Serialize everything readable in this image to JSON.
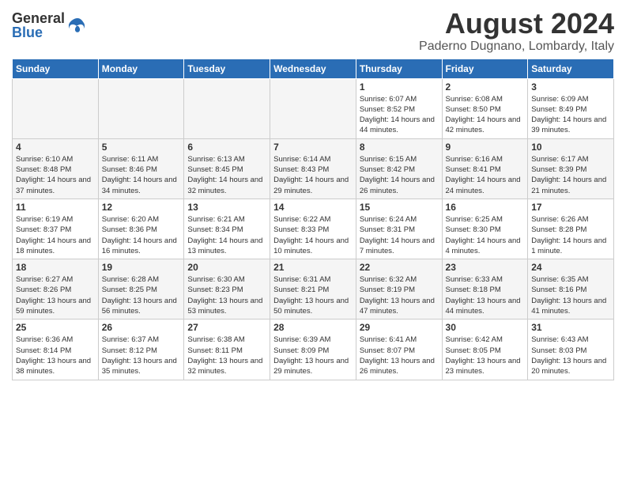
{
  "logo": {
    "general": "General",
    "blue": "Blue"
  },
  "title": {
    "month": "August 2024",
    "location": "Paderno Dugnano, Lombardy, Italy"
  },
  "headers": [
    "Sunday",
    "Monday",
    "Tuesday",
    "Wednesday",
    "Thursday",
    "Friday",
    "Saturday"
  ],
  "weeks": [
    [
      {
        "day": "",
        "info": ""
      },
      {
        "day": "",
        "info": ""
      },
      {
        "day": "",
        "info": ""
      },
      {
        "day": "",
        "info": ""
      },
      {
        "day": "1",
        "info": "Sunrise: 6:07 AM\nSunset: 8:52 PM\nDaylight: 14 hours and 44 minutes."
      },
      {
        "day": "2",
        "info": "Sunrise: 6:08 AM\nSunset: 8:50 PM\nDaylight: 14 hours and 42 minutes."
      },
      {
        "day": "3",
        "info": "Sunrise: 6:09 AM\nSunset: 8:49 PM\nDaylight: 14 hours and 39 minutes."
      }
    ],
    [
      {
        "day": "4",
        "info": "Sunrise: 6:10 AM\nSunset: 8:48 PM\nDaylight: 14 hours and 37 minutes."
      },
      {
        "day": "5",
        "info": "Sunrise: 6:11 AM\nSunset: 8:46 PM\nDaylight: 14 hours and 34 minutes."
      },
      {
        "day": "6",
        "info": "Sunrise: 6:13 AM\nSunset: 8:45 PM\nDaylight: 14 hours and 32 minutes."
      },
      {
        "day": "7",
        "info": "Sunrise: 6:14 AM\nSunset: 8:43 PM\nDaylight: 14 hours and 29 minutes."
      },
      {
        "day": "8",
        "info": "Sunrise: 6:15 AM\nSunset: 8:42 PM\nDaylight: 14 hours and 26 minutes."
      },
      {
        "day": "9",
        "info": "Sunrise: 6:16 AM\nSunset: 8:41 PM\nDaylight: 14 hours and 24 minutes."
      },
      {
        "day": "10",
        "info": "Sunrise: 6:17 AM\nSunset: 8:39 PM\nDaylight: 14 hours and 21 minutes."
      }
    ],
    [
      {
        "day": "11",
        "info": "Sunrise: 6:19 AM\nSunset: 8:37 PM\nDaylight: 14 hours and 18 minutes."
      },
      {
        "day": "12",
        "info": "Sunrise: 6:20 AM\nSunset: 8:36 PM\nDaylight: 14 hours and 16 minutes."
      },
      {
        "day": "13",
        "info": "Sunrise: 6:21 AM\nSunset: 8:34 PM\nDaylight: 14 hours and 13 minutes."
      },
      {
        "day": "14",
        "info": "Sunrise: 6:22 AM\nSunset: 8:33 PM\nDaylight: 14 hours and 10 minutes."
      },
      {
        "day": "15",
        "info": "Sunrise: 6:24 AM\nSunset: 8:31 PM\nDaylight: 14 hours and 7 minutes."
      },
      {
        "day": "16",
        "info": "Sunrise: 6:25 AM\nSunset: 8:30 PM\nDaylight: 14 hours and 4 minutes."
      },
      {
        "day": "17",
        "info": "Sunrise: 6:26 AM\nSunset: 8:28 PM\nDaylight: 14 hours and 1 minute."
      }
    ],
    [
      {
        "day": "18",
        "info": "Sunrise: 6:27 AM\nSunset: 8:26 PM\nDaylight: 13 hours and 59 minutes."
      },
      {
        "day": "19",
        "info": "Sunrise: 6:28 AM\nSunset: 8:25 PM\nDaylight: 13 hours and 56 minutes."
      },
      {
        "day": "20",
        "info": "Sunrise: 6:30 AM\nSunset: 8:23 PM\nDaylight: 13 hours and 53 minutes."
      },
      {
        "day": "21",
        "info": "Sunrise: 6:31 AM\nSunset: 8:21 PM\nDaylight: 13 hours and 50 minutes."
      },
      {
        "day": "22",
        "info": "Sunrise: 6:32 AM\nSunset: 8:19 PM\nDaylight: 13 hours and 47 minutes."
      },
      {
        "day": "23",
        "info": "Sunrise: 6:33 AM\nSunset: 8:18 PM\nDaylight: 13 hours and 44 minutes."
      },
      {
        "day": "24",
        "info": "Sunrise: 6:35 AM\nSunset: 8:16 PM\nDaylight: 13 hours and 41 minutes."
      }
    ],
    [
      {
        "day": "25",
        "info": "Sunrise: 6:36 AM\nSunset: 8:14 PM\nDaylight: 13 hours and 38 minutes."
      },
      {
        "day": "26",
        "info": "Sunrise: 6:37 AM\nSunset: 8:12 PM\nDaylight: 13 hours and 35 minutes."
      },
      {
        "day": "27",
        "info": "Sunrise: 6:38 AM\nSunset: 8:11 PM\nDaylight: 13 hours and 32 minutes."
      },
      {
        "day": "28",
        "info": "Sunrise: 6:39 AM\nSunset: 8:09 PM\nDaylight: 13 hours and 29 minutes."
      },
      {
        "day": "29",
        "info": "Sunrise: 6:41 AM\nSunset: 8:07 PM\nDaylight: 13 hours and 26 minutes."
      },
      {
        "day": "30",
        "info": "Sunrise: 6:42 AM\nSunset: 8:05 PM\nDaylight: 13 hours and 23 minutes."
      },
      {
        "day": "31",
        "info": "Sunrise: 6:43 AM\nSunset: 8:03 PM\nDaylight: 13 hours and 20 minutes."
      }
    ]
  ]
}
